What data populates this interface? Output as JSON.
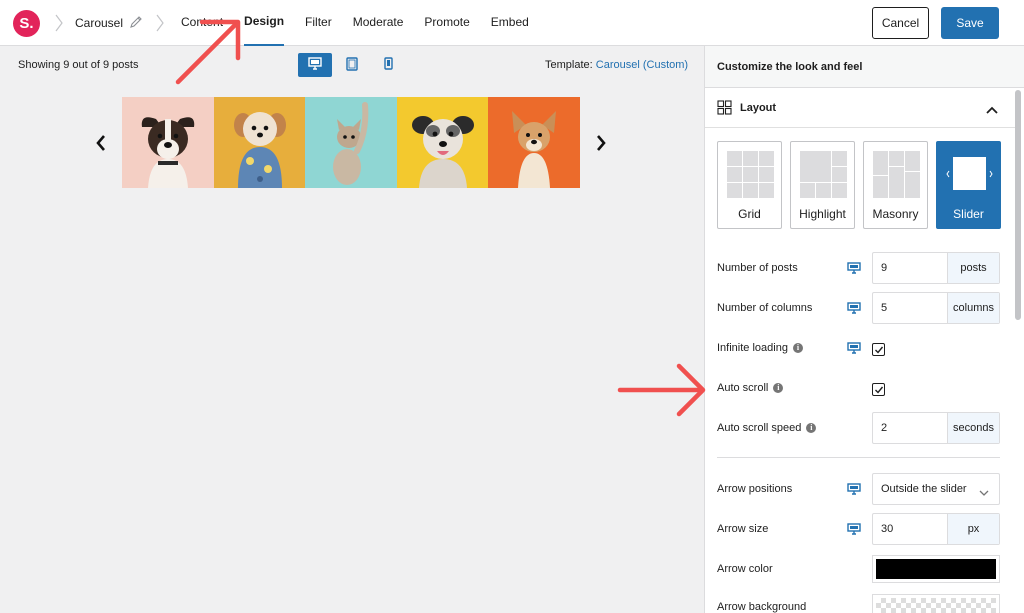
{
  "app": {
    "logo_text": "S.",
    "title": "Carousel"
  },
  "tabs": [
    {
      "label": "Content"
    },
    {
      "label": "Design"
    },
    {
      "label": "Filter"
    },
    {
      "label": "Moderate"
    },
    {
      "label": "Promote"
    },
    {
      "label": "Embed"
    }
  ],
  "active_tab": "Design",
  "actions": {
    "cancel": "Cancel",
    "save": "Save"
  },
  "preview": {
    "showing": "Showing 9 out of 9 posts",
    "template_label": "Template:",
    "template_value": "Carousel (Custom)",
    "active_device": "desktop",
    "slides": [
      {
        "subject": "dog",
        "bg": "#f4cfc4"
      },
      {
        "subject": "dog",
        "bg": "#e7ae3c"
      },
      {
        "subject": "cat",
        "bg": "#8fd6d3"
      },
      {
        "subject": "dog",
        "bg": "#f3c92e"
      },
      {
        "subject": "dog",
        "bg": "#ec6b2b"
      }
    ]
  },
  "panel": {
    "header": "Customize the look and feel",
    "section": "Layout",
    "layouts": [
      {
        "label": "Grid"
      },
      {
        "label": "Highlight"
      },
      {
        "label": "Masonry"
      },
      {
        "label": "Slider"
      }
    ],
    "active_layout": "Slider",
    "settings": {
      "num_posts": {
        "label": "Number of posts",
        "value": "9",
        "unit": "posts"
      },
      "num_columns": {
        "label": "Number of columns",
        "value": "5",
        "unit": "columns"
      },
      "infinite_loading": {
        "label": "Infinite loading",
        "checked": true
      },
      "auto_scroll": {
        "label": "Auto scroll",
        "checked": true
      },
      "auto_scroll_speed": {
        "label": "Auto scroll speed",
        "value": "2",
        "unit": "seconds"
      },
      "arrow_positions": {
        "label": "Arrow positions",
        "value": "Outside the slider"
      },
      "arrow_size": {
        "label": "Arrow size",
        "value": "30",
        "unit": "px"
      },
      "arrow_color": {
        "label": "Arrow color",
        "value": "#000000"
      },
      "arrow_background": {
        "label": "Arrow background",
        "value": "transparent"
      }
    }
  },
  "colors": {
    "accent": "#2271b1",
    "brand": "#e2245a",
    "annotation": "#f0504f"
  }
}
